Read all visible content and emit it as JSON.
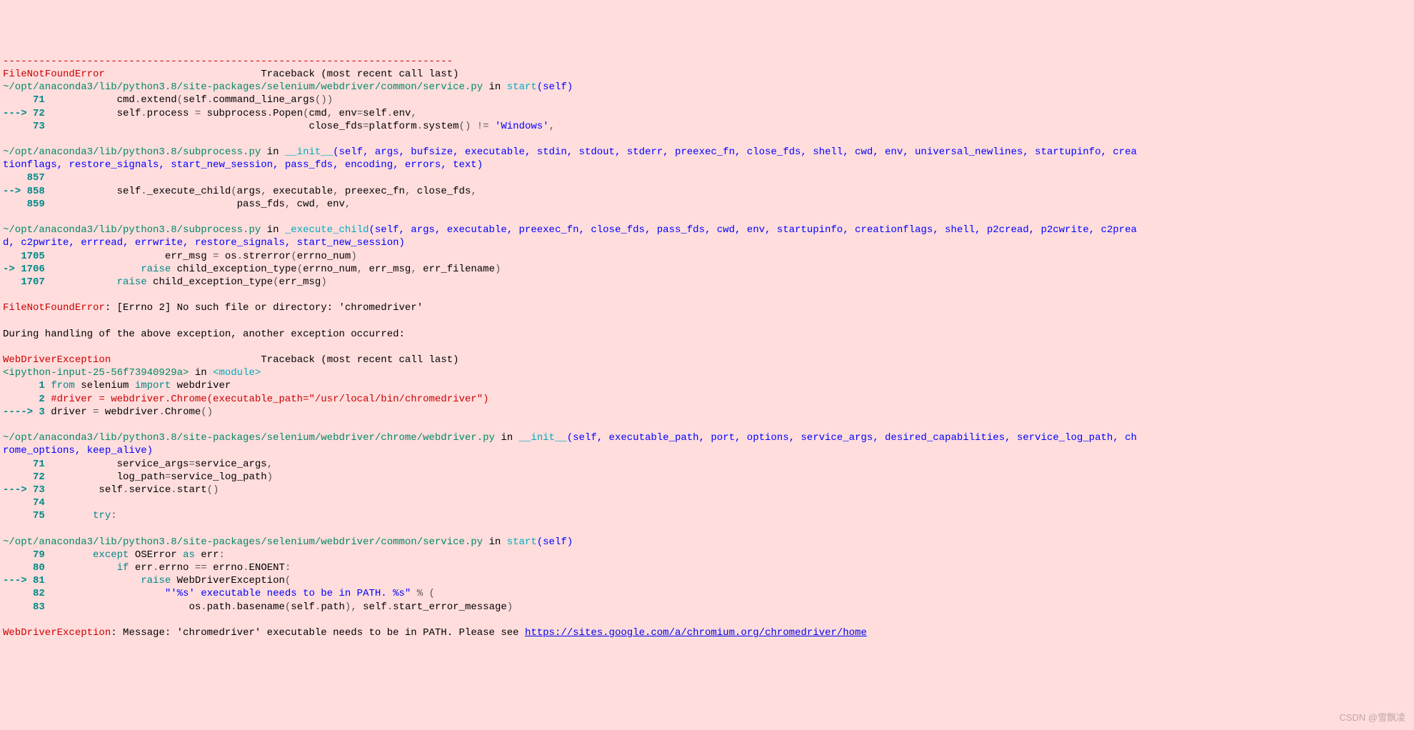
{
  "dashes": "---------------------------------------------------------------------------",
  "err1_name": "FileNotFoundError",
  "traceback_label": "Traceback (most recent call last)",
  "frame1": {
    "path": "~/opt/anaconda3/lib/python3.8/site-packages/selenium/webdriver/common/service.py",
    "in_label": " in ",
    "func": "start",
    "args": "(self)",
    "line71_num": "     71",
    "line71_code_a": "            cmd",
    "line71_code_b": "extend",
    "line71_code_c": "self",
    "line71_code_d": "command_line_args",
    "line72_arrow": "---> 72",
    "line72_a": "            self",
    "line72_b": "process ",
    "line72_c": " subprocess",
    "line72_d": "Popen",
    "line72_e": "cmd",
    "line72_f": " env",
    "line72_g": "self",
    "line72_h": "env",
    "line73_num": "     73",
    "line73_a": "                                            close_fds",
    "line73_b": "platform",
    "line73_c": "system",
    "line73_d": "'Windows'"
  },
  "frame2": {
    "path": "~/opt/anaconda3/lib/python3.8/subprocess.py",
    "in_label": " in ",
    "func": "__init__",
    "args": "(self, args, bufsize, executable, stdin, stdout, stderr, preexec_fn, close_fds, shell, cwd, env, universal_newlines, startupinfo, crea\ntionflags, restore_signals, start_new_session, pass_fds, encoding, errors, text)",
    "line857_num": "    857",
    "line858_arrow": "--> 858",
    "line858_a": "            self",
    "line858_b": "_execute_child",
    "line858_c": "args",
    "line858_d": " executable",
    "line858_e": " preexec_fn",
    "line858_f": " close_fds",
    "line859_num": "    859",
    "line859_a": "                                pass_fds",
    "line859_b": " cwd",
    "line859_c": " env"
  },
  "frame3": {
    "path": "~/opt/anaconda3/lib/python3.8/subprocess.py",
    "in_label": " in ",
    "func": "_execute_child",
    "args": "(self, args, executable, preexec_fn, close_fds, pass_fds, cwd, env, startupinfo, creationflags, shell, p2cread, p2cwrite, c2prea\nd, c2pwrite, errread, errwrite, restore_signals, start_new_session)",
    "line1705_num": "   1705",
    "line1705_a": "                    err_msg ",
    "line1705_b": " os",
    "line1705_c": "strerror",
    "line1705_d": "errno_num",
    "line1706_arrow": "-> 1706",
    "line1706_a": "                ",
    "raise": "raise",
    "line1706_b": " child_exception_type",
    "line1706_c": "errno_num",
    "line1706_d": " err_msg",
    "line1706_e": " err_filename",
    "line1707_num": "   1707",
    "line1707_a": "            ",
    "line1707_b": " child_exception_type",
    "line1707_c": "err_msg"
  },
  "error1_text": ": [Errno 2] No such file or directory: 'chromedriver'",
  "during_text": "During handling of the above exception, another exception occurred:",
  "err2_name": "WebDriverException",
  "frame4": {
    "file": "<ipython-input-25-56f73940929a>",
    "in_label": " in ",
    "func": "<module>",
    "line1_num": "      1",
    "line1_from": "from",
    "line1_sel": " selenium ",
    "line1_import": "import",
    "line1_wd": " webdriver",
    "line2_num": "      2",
    "line2_comment": " #driver = webdriver.Chrome(executable_path=\"/usr/local/bin/chromedriver\")",
    "line3_arrow": "----> 3",
    "line3_a": " driver ",
    "line3_b": " webdriver",
    "line3_c": "Chrome"
  },
  "frame5": {
    "path": "~/opt/anaconda3/lib/python3.8/site-packages/selenium/webdriver/chrome/webdriver.py",
    "in_label": " in ",
    "func": "__init__",
    "args": "(self, executable_path, port, options, service_args, desired_capabilities, service_log_path, ch\nrome_options, keep_alive)",
    "line71_num": "     71",
    "line71_a": "            service_args",
    "line71_b": "service_args",
    "line72_num": "     72",
    "line72_a": "            log_path",
    "line72_b": "service_log_path",
    "line73_arrow": "---> 73",
    "line73_a": "         self",
    "line73_b": "service",
    "line73_c": "start",
    "line74_num": "     74",
    "line75_num": "     75",
    "line75_try": "        try"
  },
  "frame6": {
    "path": "~/opt/anaconda3/lib/python3.8/site-packages/selenium/webdriver/common/service.py",
    "in_label": " in ",
    "func": "start",
    "args": "(self)",
    "line79_num": "     79",
    "line79_except": "        except",
    "line79_a": " OSError ",
    "line79_as": "as",
    "line79_b": " err",
    "line80_num": "     80",
    "line80_if": "            if",
    "line80_a": " err",
    "line80_b": "errno ",
    "line80_eq": "==",
    "line80_c": " errno",
    "line80_d": "ENOENT",
    "line81_arrow": "---> 81",
    "line81_a": "                ",
    "line81_raise": "raise",
    "line81_b": " WebDriverException",
    "line82_num": "     82",
    "line82_a": "                    \"'%s' executable needs to be in PATH. %s\"",
    "line82_b": " % (",
    "line83_num": "     83",
    "line83_a": "                        os",
    "line83_b": "path",
    "line83_c": "basename",
    "line83_d": "self",
    "line83_e": "path",
    "line83_f": " self",
    "line83_g": "start_error_message"
  },
  "final_error": ": Message: 'chromedriver' executable needs to be in PATH. Please see ",
  "final_url": "https://sites.google.com/a/chromium.org/chromedriver/home",
  "watermark": "CSDN @雪飘凌"
}
